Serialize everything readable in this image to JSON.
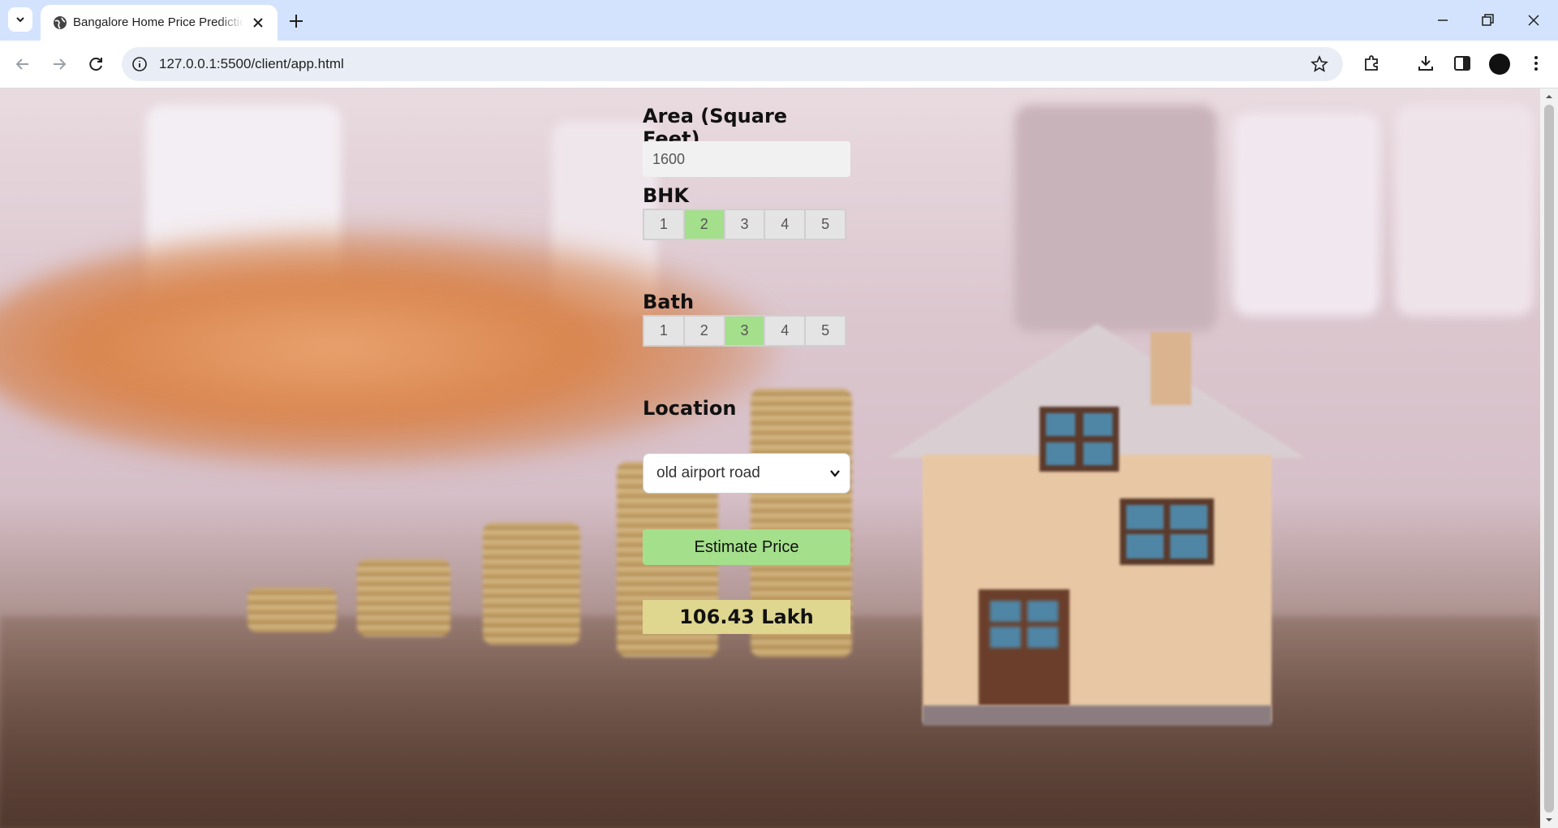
{
  "browser": {
    "tab_title": "Bangalore Home Price Prediction",
    "url": "127.0.0.1:5500/client/app.html"
  },
  "form": {
    "area_label": "Area (Square Feet)",
    "area_value": "1600",
    "bhk_label": "BHK",
    "bhk_options": [
      "1",
      "2",
      "3",
      "4",
      "5"
    ],
    "bhk_selected": "2",
    "bath_label": "Bath",
    "bath_options": [
      "1",
      "2",
      "3",
      "4",
      "5"
    ],
    "bath_selected": "3",
    "location_label": "Location",
    "location_selected": "old airport road",
    "estimate_button": "Estimate Price",
    "result": "106.43 Lakh"
  },
  "colors": {
    "selected_option": "#a4df8b",
    "button": "#a4df8b",
    "result_bg": "#dfd68f",
    "tabstrip": "#d3e3fd"
  }
}
